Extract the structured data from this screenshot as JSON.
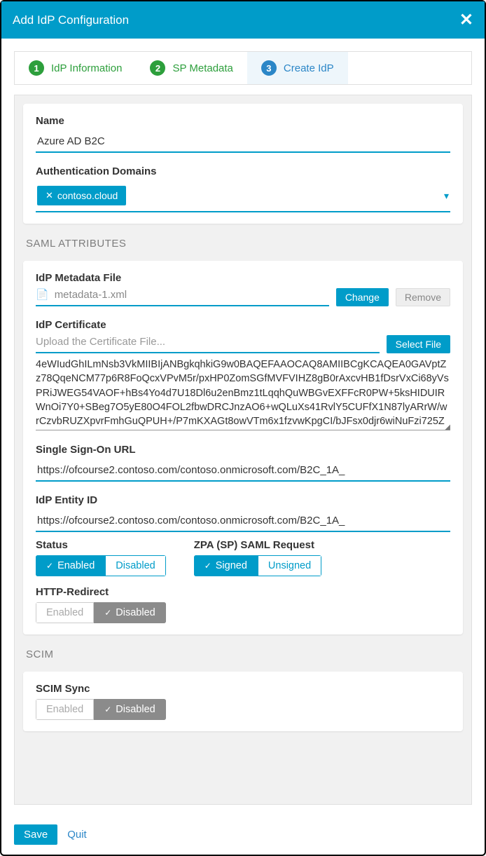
{
  "title": "Add IdP Configuration",
  "steps": [
    {
      "num": "1",
      "label": "IdP Information"
    },
    {
      "num": "2",
      "label": "SP Metadata"
    },
    {
      "num": "3",
      "label": "Create IdP"
    }
  ],
  "name_label": "Name",
  "name_value": "Azure AD B2C",
  "auth_domain_label": "Authentication Domains",
  "auth_domain_chip": "contoso.cloud",
  "saml_section": "SAML ATTRIBUTES",
  "metadata_label": "IdP Metadata File",
  "metadata_filename": "metadata-1.xml",
  "change_btn": "Change",
  "remove_btn": "Remove",
  "cert_label": "IdP Certificate",
  "cert_placeholder": "Upload the Certificate File...",
  "select_file_btn": "Select File",
  "cert_block": "4eWIudGhILmNsb3VkMIIBIjANBgkqhkiG9w0BAQEFAAOCAQ8AMIIBCgKCAQEA0GAVptZz78QqeNCM77p6R8FoQcxVPvM5r/pxHP0ZomSGfMVFVIHZ8gB0rAxcvHB1fDsrVxCi68yVsPRiJWEG54VAOF+hBs4Yo4d7U18Dl6u2enBmz1tLqqhQuWBGvEXFFcR0PW+5ksHIDUIRWnOi7Y0+SBeg7O5yE80O4FOL2fbwDRCJnzAO6+wQLuXs41RvlY5CUFfX1N87lyARrW/wrCzvbRUZXpvrFmhGuQPUH+/P7mKXAGt8owVTm6x1fzvwKpgCI/bJFsx0djr6wiNuFzi725Z",
  "sso_label": "Single Sign-On URL",
  "sso_value": "https://ofcourse2.contoso.com/contoso.onmicrosoft.com/B2C_1A_",
  "entity_label": "IdP Entity ID",
  "entity_value": "https://ofcourse2.contoso.com/contoso.onmicrosoft.com/B2C_1A_",
  "status_label": "Status",
  "status_on": "Enabled",
  "status_off": "Disabled",
  "zpa_label": "ZPA (SP) SAML Request",
  "zpa_on": "Signed",
  "zpa_off": "Unsigned",
  "http_label": "HTTP-Redirect",
  "http_on": "Enabled",
  "http_off": "Disabled",
  "scim_section": "SCIM",
  "scim_sync_label": "SCIM Sync",
  "scim_on": "Enabled",
  "scim_off": "Disabled",
  "save_btn": "Save",
  "quit_btn": "Quit"
}
